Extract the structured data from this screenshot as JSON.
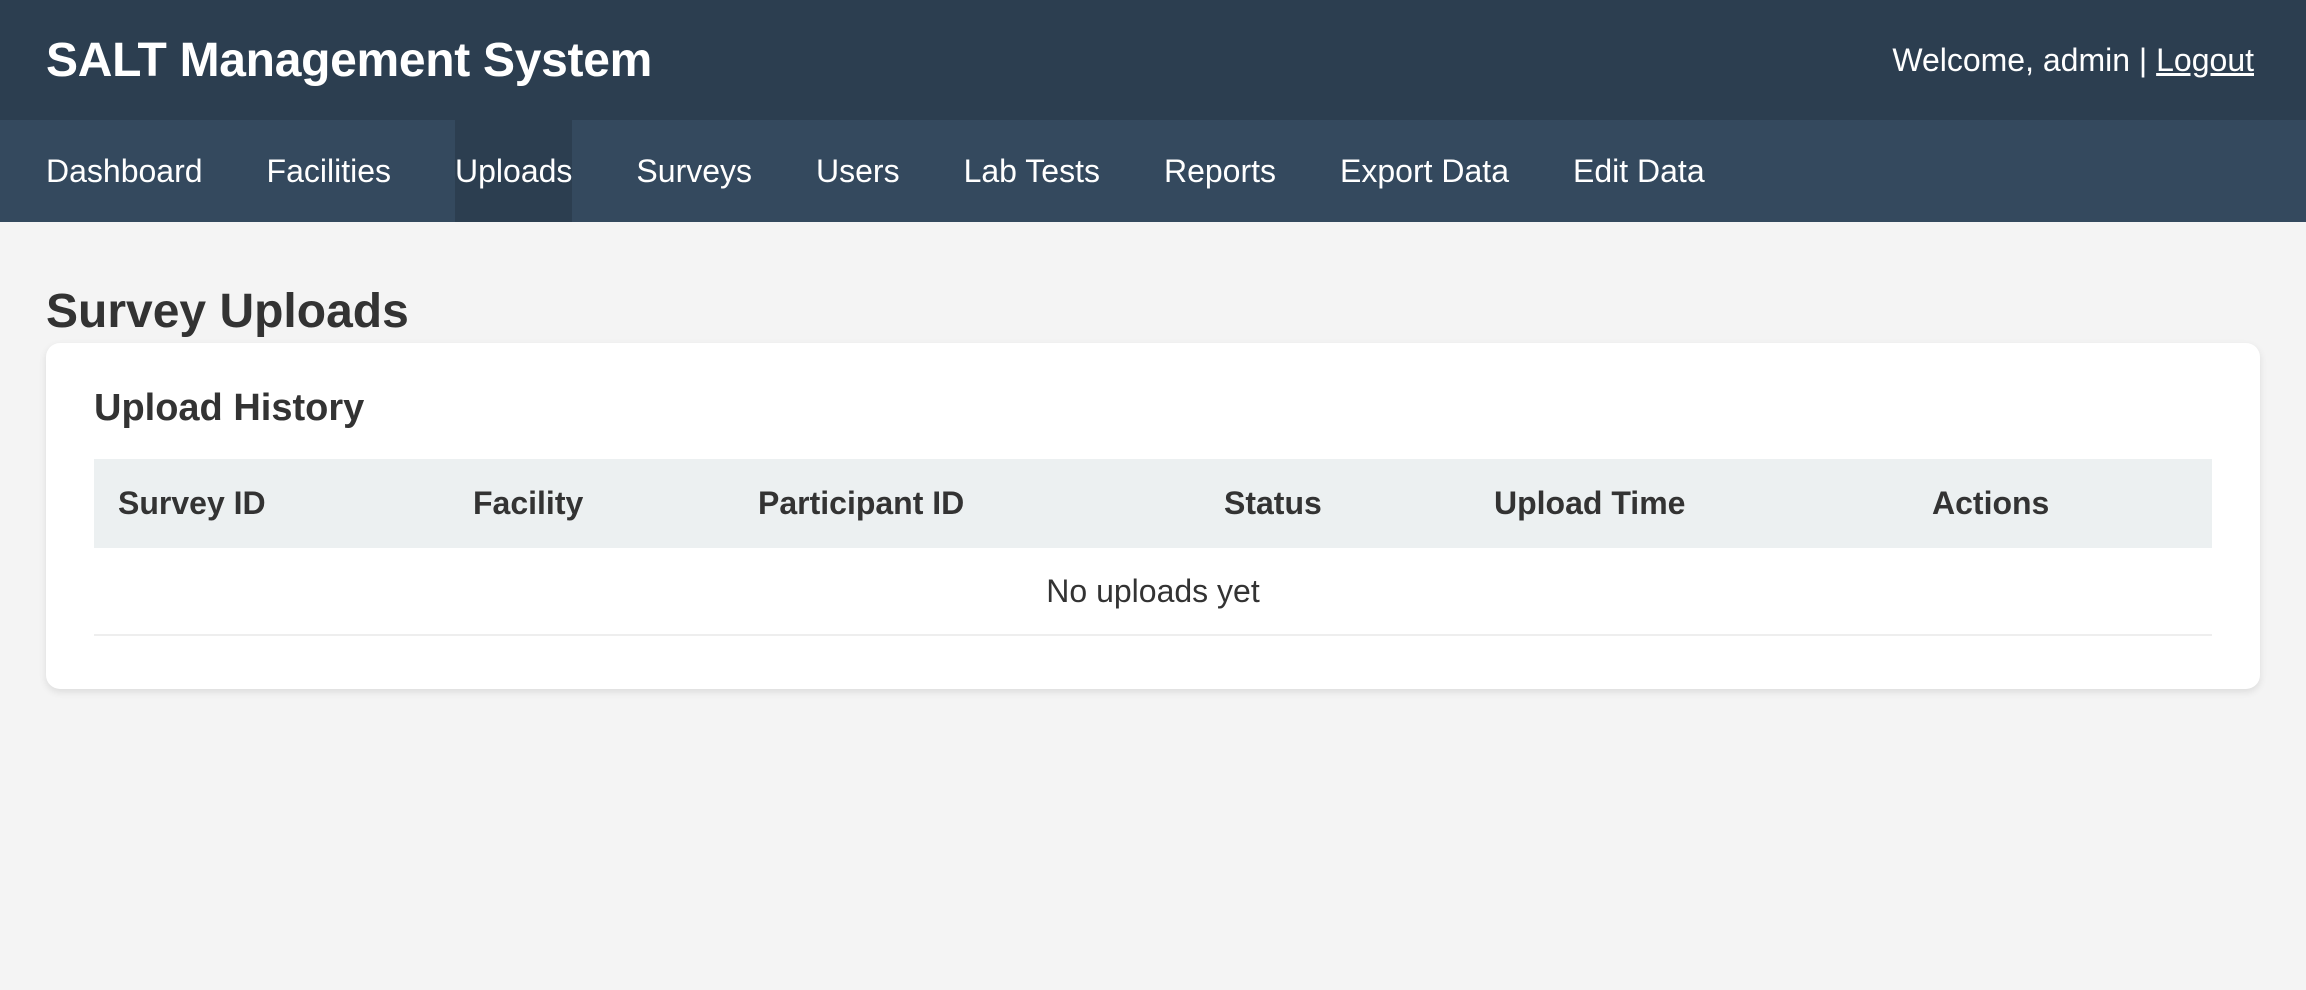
{
  "header": {
    "title": "SALT Management System",
    "welcome_text": "Welcome, admin | ",
    "logout_label": "Logout"
  },
  "nav": {
    "items": [
      {
        "label": "Dashboard",
        "active": false
      },
      {
        "label": "Facilities",
        "active": false
      },
      {
        "label": "Uploads",
        "active": true
      },
      {
        "label": "Surveys",
        "active": false
      },
      {
        "label": "Users",
        "active": false
      },
      {
        "label": "Lab Tests",
        "active": false
      },
      {
        "label": "Reports",
        "active": false
      },
      {
        "label": "Export Data",
        "active": false
      },
      {
        "label": "Edit Data",
        "active": false
      }
    ]
  },
  "main": {
    "page_title": "Survey Uploads",
    "card": {
      "title": "Upload History",
      "table": {
        "columns": [
          "Survey ID",
          "Facility",
          "Participant ID",
          "Status",
          "Upload Time",
          "Actions"
        ],
        "empty_message": "No uploads yet"
      }
    }
  },
  "colors": {
    "header_bg": "#2c3e50",
    "nav_bg": "#34495e",
    "nav_active_bg": "#2c3e50",
    "page_bg": "#f4f4f4",
    "table_header_bg": "#ecf0f1"
  }
}
